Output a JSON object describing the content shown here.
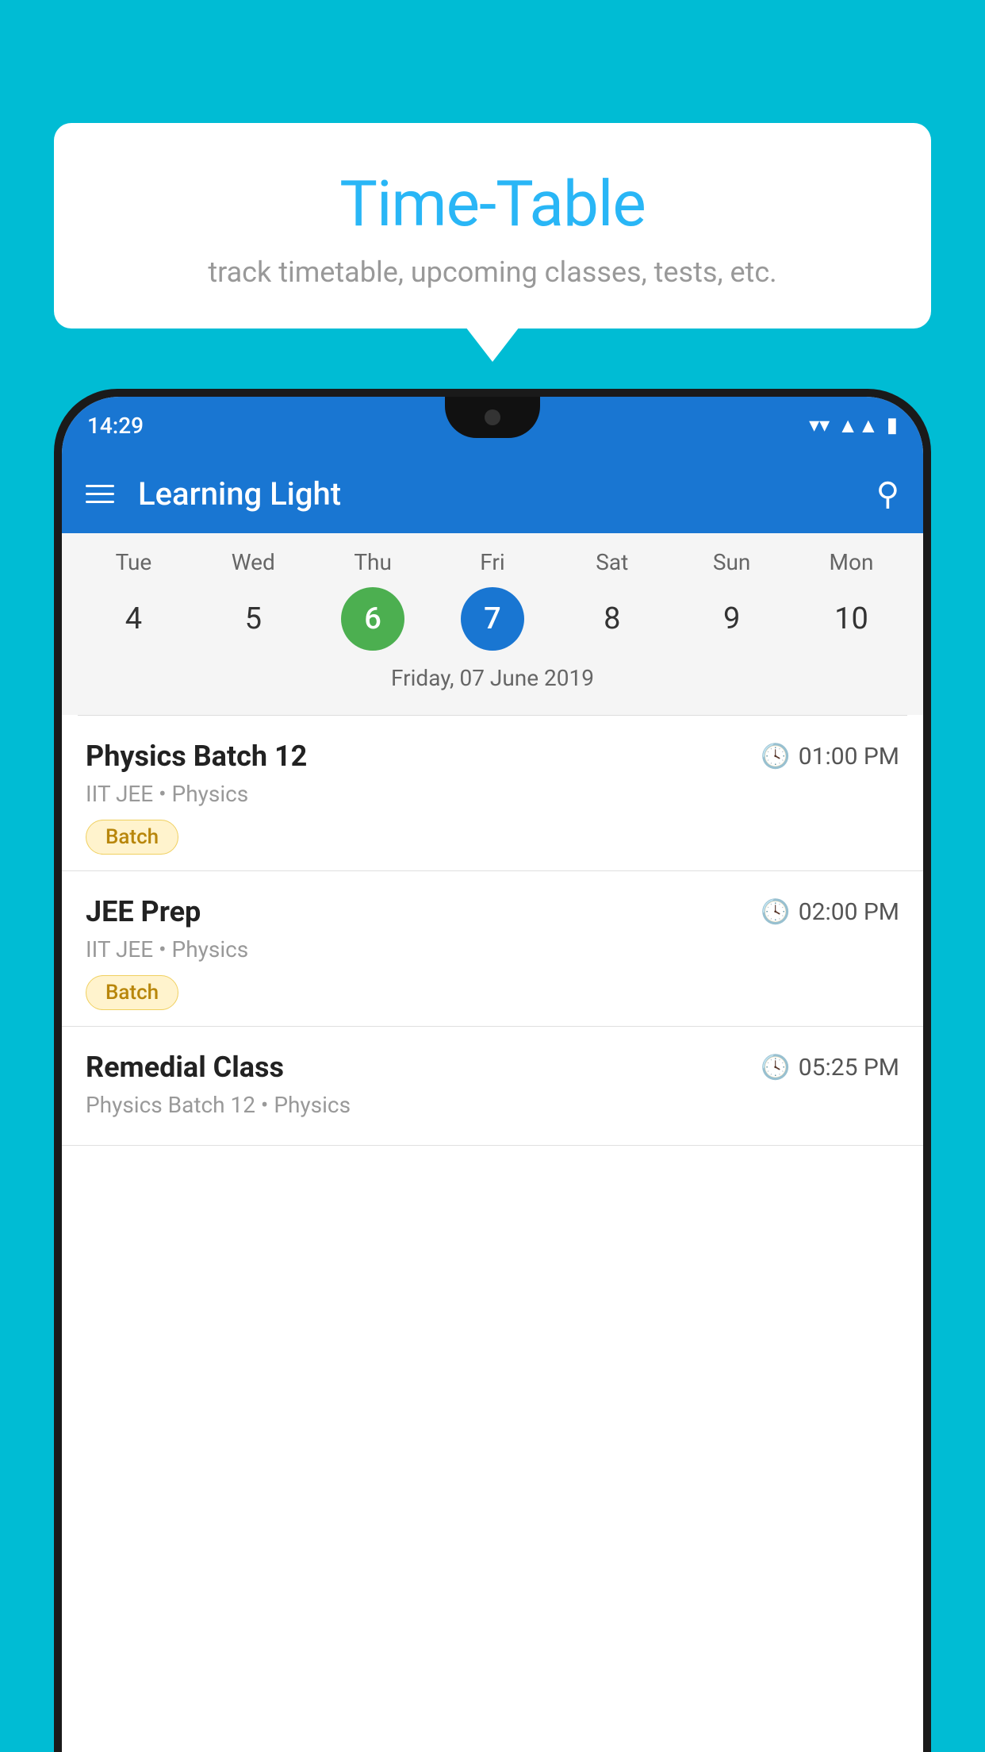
{
  "page": {
    "background_color": "#00BCD4"
  },
  "bubble": {
    "title": "Time-Table",
    "subtitle": "track timetable, upcoming classes, tests, etc."
  },
  "phone": {
    "status_bar": {
      "time": "14:29"
    },
    "app_bar": {
      "title": "Learning Light"
    },
    "calendar": {
      "days": [
        {
          "label": "Tue",
          "num": "4"
        },
        {
          "label": "Wed",
          "num": "5"
        },
        {
          "label": "Thu",
          "num": "6",
          "state": "today"
        },
        {
          "label": "Fri",
          "num": "7",
          "state": "selected"
        },
        {
          "label": "Sat",
          "num": "8"
        },
        {
          "label": "Sun",
          "num": "9"
        },
        {
          "label": "Mon",
          "num": "10"
        }
      ],
      "selected_date": "Friday, 07 June 2019"
    },
    "classes": [
      {
        "name": "Physics Batch 12",
        "time": "01:00 PM",
        "meta": "IIT JEE • Physics",
        "badge": "Batch"
      },
      {
        "name": "JEE Prep",
        "time": "02:00 PM",
        "meta": "IIT JEE • Physics",
        "badge": "Batch"
      },
      {
        "name": "Remedial Class",
        "time": "05:25 PM",
        "meta": "Physics Batch 12 • Physics",
        "badge": null
      }
    ]
  }
}
